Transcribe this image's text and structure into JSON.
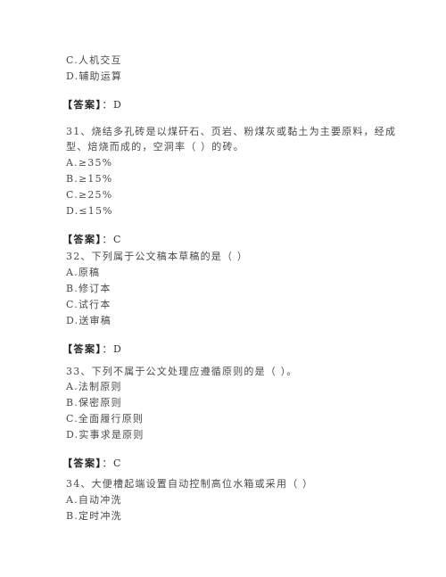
{
  "document": {
    "prev_question_tail": {
      "options": [
        {
          "label": "C.",
          "text": "人机交互"
        },
        {
          "label": "D.",
          "text": "辅助运算"
        }
      ],
      "answer": {
        "prefix": "【答案】",
        "sep": "：",
        "value": "D"
      }
    },
    "questions": [
      {
        "number": "31、",
        "stem_lines": [
          "烧结多孔砖是以煤矸石、页岩、粉煤灰或黏土为主要原料，经成",
          "型、焙烧而成的，空洞率（    ）的砖。"
        ],
        "options": [
          {
            "label": "A.",
            "text": "≥35%"
          },
          {
            "label": "B.",
            "text": "≥15%"
          },
          {
            "label": "C.",
            "text": "≥25%"
          },
          {
            "label": "D.",
            "text": "≤15%"
          }
        ],
        "answer": {
          "prefix": "【答案】",
          "sep": "：",
          "value": "C"
        }
      },
      {
        "number": "32、",
        "stem_lines": [
          "下列属于公文稿本草稿的是（    ）"
        ],
        "options": [
          {
            "label": "A.",
            "text": "原稿"
          },
          {
            "label": "B.",
            "text": "修订本"
          },
          {
            "label": "C.",
            "text": "试行本"
          },
          {
            "label": "D.",
            "text": "送审稿"
          }
        ],
        "answer": {
          "prefix": "【答案】",
          "sep": "：",
          "value": "D"
        }
      },
      {
        "number": "33、",
        "stem_lines": [
          "下列不属于公文处理应遵循原则的是（    ）。"
        ],
        "options": [
          {
            "label": "A.",
            "text": "法制原则"
          },
          {
            "label": "B.",
            "text": "保密原则"
          },
          {
            "label": "C.",
            "text": "全面履行原则"
          },
          {
            "label": "D.",
            "text": "实事求是原则"
          }
        ],
        "answer": {
          "prefix": "【答案】",
          "sep": "：",
          "value": "C"
        }
      },
      {
        "number": "34、",
        "stem_lines": [
          "大便槽起端设置自动控制高位水箱或采用（    ）"
        ],
        "options": [
          {
            "label": "A.",
            "text": "自动冲洗"
          },
          {
            "label": "B.",
            "text": "定时冲洗"
          }
        ]
      }
    ]
  }
}
